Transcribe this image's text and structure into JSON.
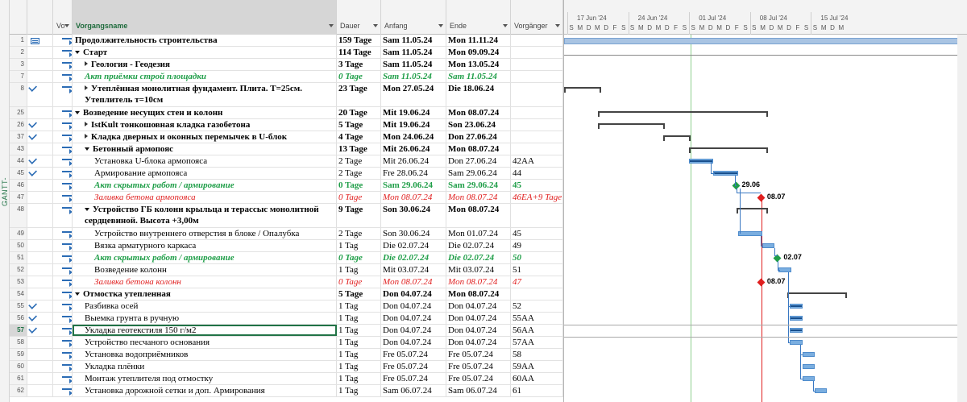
{
  "side_label": "GANTT-DIAGRAMM",
  "columns": {
    "mode": "Vo",
    "name": "Vorgangsname",
    "duration": "Dauer",
    "start": "Anfang",
    "end": "Ende",
    "predecessors": "Vorgänger"
  },
  "timeline": {
    "weeks": [
      "17 Jun '24",
      "24 Jun '24",
      "01 Jul '24",
      "08 Jul '24",
      "15 Jul '24"
    ],
    "day_letters": [
      "S",
      "M",
      "D",
      "M",
      "D",
      "F",
      "S",
      "S",
      "M",
      "D",
      "M",
      "D",
      "F",
      "S",
      "S",
      "M",
      "D",
      "M",
      "D",
      "F",
      "S",
      "S",
      "M",
      "D",
      "M",
      "D",
      "F",
      "S",
      "S",
      "M",
      "D",
      "M"
    ],
    "milestone_labels": [
      "29.06",
      "08.07",
      "02.07",
      "08.07"
    ]
  },
  "colors": {
    "accent_green": "#217346",
    "milestone_green": "#1f9e48",
    "milestone_red": "#e01f1f",
    "bar_blue": "#7aaee0"
  },
  "rows": [
    {
      "id": "1",
      "check": false,
      "icon": "summary",
      "name": "Продолжительность строительства",
      "dur": "159 Tage",
      "start": "Sam 11.05.24",
      "end": "Mon 11.11.24",
      "pred": "",
      "style": "bold",
      "indent": 0,
      "tri": ""
    },
    {
      "id": "2",
      "check": false,
      "icon": "task",
      "name": "Старт",
      "dur": "114 Tage",
      "start": "Sam 11.05.24",
      "end": "Mon 09.09.24",
      "pred": "",
      "style": "bold",
      "indent": 0,
      "tri": "exp"
    },
    {
      "id": "3",
      "check": false,
      "icon": "task",
      "name": "Геология - Геодезия",
      "dur": "3 Tage",
      "start": "Sam 11.05.24",
      "end": "Mon 13.05.24",
      "pred": "",
      "style": "bold",
      "indent": 1,
      "tri": "col"
    },
    {
      "id": "7",
      "check": false,
      "icon": "task",
      "name": "Акт приёмки строй площадки",
      "dur": "0 Tage",
      "start": "Sam 11.05.24",
      "end": "Sam 11.05.24",
      "pred": "",
      "style": "ms",
      "indent": 1,
      "tri": ""
    },
    {
      "id": "8",
      "check": true,
      "icon": "task",
      "name": "Утеплённая монолитная фундамент. Плита. Т=25см. Утеплитель т=10см",
      "dur": "23 Tage",
      "start": "Mon 27.05.24",
      "end": "Die 18.06.24",
      "pred": "",
      "style": "bold",
      "indent": 1,
      "tri": "col",
      "tall": true
    },
    {
      "id": "25",
      "check": false,
      "icon": "task",
      "name": "Возведение несущих стен и колонн",
      "dur": "20 Tage",
      "start": "Mit 19.06.24",
      "end": "Mon 08.07.24",
      "pred": "",
      "style": "bold",
      "indent": 0,
      "tri": "exp"
    },
    {
      "id": "26",
      "check": true,
      "icon": "task",
      "name": "IstKult тонкошовная кладка газобетона",
      "dur": "5 Tage",
      "start": "Mit 19.06.24",
      "end": "Son 23.06.24",
      "pred": "",
      "style": "bold",
      "indent": 1,
      "tri": "col"
    },
    {
      "id": "37",
      "check": true,
      "icon": "task",
      "name": "Кладка дверных и оконных перемычек в U-блок",
      "dur": "4 Tage",
      "start": "Mon 24.06.24",
      "end": "Don 27.06.24",
      "pred": "",
      "style": "bold",
      "indent": 1,
      "tri": "col"
    },
    {
      "id": "43",
      "check": false,
      "icon": "task",
      "name": "Бетонный армопояс",
      "dur": "13 Tage",
      "start": "Mit 26.06.24",
      "end": "Mon 08.07.24",
      "pred": "",
      "style": "bold",
      "indent": 1,
      "tri": "exp"
    },
    {
      "id": "44",
      "check": true,
      "icon": "task",
      "name": "Установка U-блока армопояса",
      "dur": "2 Tage",
      "start": "Mit 26.06.24",
      "end": "Don 27.06.24",
      "pred": "42AA",
      "style": "",
      "indent": 2,
      "tri": ""
    },
    {
      "id": "45",
      "check": true,
      "icon": "task",
      "name": "Армирование армопояса",
      "dur": "2 Tage",
      "start": "Fre 28.06.24",
      "end": "Sam 29.06.24",
      "pred": "44",
      "style": "",
      "indent": 2,
      "tri": ""
    },
    {
      "id": "46",
      "check": false,
      "icon": "task",
      "name": "Акт скрытых работ / армирование",
      "dur": "0 Tage",
      "start": "Sam 29.06.24",
      "end": "Sam 29.06.24",
      "pred": "45",
      "style": "msb",
      "indent": 2,
      "tri": ""
    },
    {
      "id": "47",
      "check": false,
      "icon": "task",
      "name": "Заливка бетона армопояса",
      "dur": "0 Tage",
      "start": "Mon 08.07.24",
      "end": "Mon 08.07.24",
      "pred": "46EA+9 Tage",
      "style": "red",
      "indent": 2,
      "tri": ""
    },
    {
      "id": "48",
      "check": false,
      "icon": "task",
      "name": "Устройство ГБ колонн крыльца и терассыс монолитной сердцевиной. Высота +3,00м",
      "dur": "9 Tage",
      "start": "Son 30.06.24",
      "end": "Mon 08.07.24",
      "pred": "",
      "style": "bold",
      "indent": 1,
      "tri": "exp",
      "tall": true
    },
    {
      "id": "49",
      "check": false,
      "icon": "task",
      "name": "Устройство внутреннего отверстия в блоке / Опалубка",
      "dur": "2 Tage",
      "start": "Son 30.06.24",
      "end": "Mon 01.07.24",
      "pred": "45",
      "style": "",
      "indent": 2,
      "tri": ""
    },
    {
      "id": "50",
      "check": false,
      "icon": "task",
      "name": "Вязка арматурного каркаса",
      "dur": "1 Tag",
      "start": "Die 02.07.24",
      "end": "Die 02.07.24",
      "pred": "49",
      "style": "",
      "indent": 2,
      "tri": ""
    },
    {
      "id": "51",
      "check": false,
      "icon": "task",
      "name": "Акт скрытых работ / армирование",
      "dur": "0 Tage",
      "start": "Die 02.07.24",
      "end": "Die 02.07.24",
      "pred": "50",
      "style": "ms",
      "indent": 2,
      "tri": ""
    },
    {
      "id": "52",
      "check": false,
      "icon": "task",
      "name": "Возведение колонн",
      "dur": "1 Tag",
      "start": "Mit 03.07.24",
      "end": "Mit 03.07.24",
      "pred": "51",
      "style": "",
      "indent": 2,
      "tri": ""
    },
    {
      "id": "53",
      "check": false,
      "icon": "task",
      "name": "Заливка бетона колонн",
      "dur": "0 Tage",
      "start": "Mon 08.07.24",
      "end": "Mon 08.07.24",
      "pred": "47",
      "style": "red",
      "indent": 2,
      "tri": ""
    },
    {
      "id": "54",
      "check": false,
      "icon": "task",
      "name": "Отмостка утепленная",
      "dur": "5 Tage",
      "start": "Don 04.07.24",
      "end": "Mon 08.07.24",
      "pred": "",
      "style": "bold",
      "indent": 0,
      "tri": "exp"
    },
    {
      "id": "55",
      "check": true,
      "icon": "task",
      "name": "Разбивка осей",
      "dur": "1 Tag",
      "start": "Don 04.07.24",
      "end": "Don 04.07.24",
      "pred": "52",
      "style": "",
      "indent": 1,
      "tri": ""
    },
    {
      "id": "56",
      "check": true,
      "icon": "task",
      "name": "Выемка грунта в ручную",
      "dur": "1 Tag",
      "start": "Don 04.07.24",
      "end": "Don 04.07.24",
      "pred": "55AA",
      "style": "",
      "indent": 1,
      "tri": ""
    },
    {
      "id": "57",
      "check": true,
      "icon": "task",
      "name": "Укладка геотекстиля 150 г/м2",
      "dur": "1 Tag",
      "start": "Don 04.07.24",
      "end": "Don 04.07.24",
      "pred": "56AA",
      "style": "",
      "indent": 1,
      "tri": "",
      "selected": true
    },
    {
      "id": "58",
      "check": false,
      "icon": "task",
      "name": "Устройство песчаного основания",
      "dur": "1 Tag",
      "start": "Don 04.07.24",
      "end": "Don 04.07.24",
      "pred": "57AA",
      "style": "",
      "indent": 1,
      "tri": ""
    },
    {
      "id": "59",
      "check": false,
      "icon": "task",
      "name": "Установка водоприёмников",
      "dur": "1 Tag",
      "start": "Fre 05.07.24",
      "end": "Fre 05.07.24",
      "pred": "58",
      "style": "",
      "indent": 1,
      "tri": ""
    },
    {
      "id": "60",
      "check": false,
      "icon": "task",
      "name": "Укладка плёнки",
      "dur": "1 Tag",
      "start": "Fre 05.07.24",
      "end": "Fre 05.07.24",
      "pred": "59AA",
      "style": "",
      "indent": 1,
      "tri": ""
    },
    {
      "id": "61",
      "check": false,
      "icon": "task",
      "name": "Монтаж утеплителя под отмостку",
      "dur": "1 Tag",
      "start": "Fre 05.07.24",
      "end": "Fre 05.07.24",
      "pred": "60AA",
      "style": "",
      "indent": 1,
      "tri": ""
    },
    {
      "id": "62",
      "check": false,
      "icon": "task",
      "name": "Установка дорожной сетки и доп. Армирования",
      "dur": "1 Tag",
      "start": "Sam 06.07.24",
      "end": "Sam 06.07.24",
      "pred": "61",
      "style": "",
      "indent": 1,
      "tri": ""
    }
  ]
}
